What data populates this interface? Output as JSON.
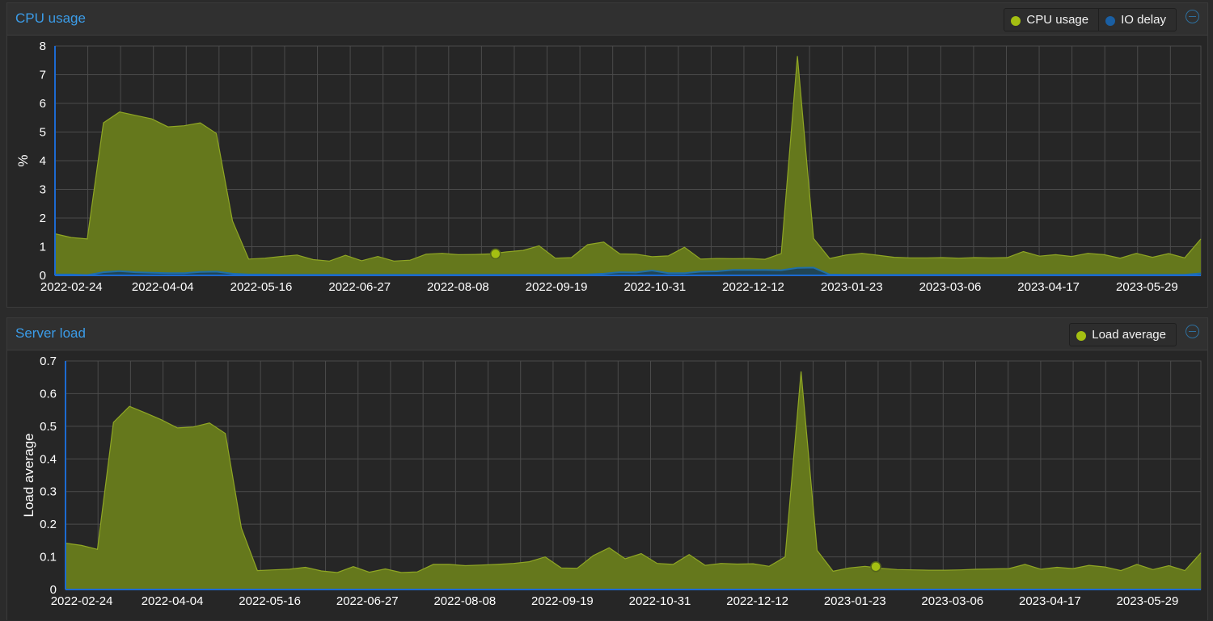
{
  "colors": {
    "cpu_fill": "#65781c",
    "cpu_line": "#8fa624",
    "cpu_dot": "#a4bf12",
    "io_fill": "#1a3f5c",
    "io_line": "#1f6fa8",
    "io_dot": "#1a5fa3",
    "grid": "#4b4b4b",
    "axis": "#1c6ad1"
  },
  "panels": {
    "cpu": {
      "title": "CPU usage",
      "legend": [
        {
          "label": "CPU usage",
          "color": "#a4bf12"
        },
        {
          "label": "IO delay",
          "color": "#1a5fa3"
        }
      ]
    },
    "load": {
      "title": "Server load",
      "legend": [
        {
          "label": "Load average",
          "color": "#a4bf12"
        }
      ]
    }
  },
  "chart_data": [
    {
      "type": "area",
      "title": "CPU usage",
      "xlabel": "",
      "ylabel": "%",
      "ylim": [
        0,
        8
      ],
      "yticks": [
        "0",
        "1",
        "2",
        "3",
        "4",
        "5",
        "6",
        "7",
        "8"
      ],
      "xticks": [
        "2022-02-24",
        "2022-04-04",
        "2022-05-16",
        "2022-06-27",
        "2022-08-08",
        "2022-09-19",
        "2022-10-31",
        "2022-12-12",
        "2023-01-23",
        "2023-03-06",
        "2023-04-17",
        "2023-05-29"
      ],
      "grid": true,
      "legend_position": "top-right",
      "x_start": "2022-02-17",
      "x_end": "2023-06-21",
      "series": [
        {
          "name": "CPU usage",
          "values": [
            1.45,
            1.32,
            1.27,
            5.32,
            5.7,
            5.58,
            5.46,
            5.18,
            5.22,
            5.32,
            4.95,
            1.9,
            0.57,
            0.6,
            0.66,
            0.71,
            0.55,
            0.5,
            0.7,
            0.51,
            0.66,
            0.5,
            0.53,
            0.74,
            0.77,
            0.72,
            0.73,
            0.75,
            0.82,
            0.87,
            1.03,
            0.6,
            0.62,
            1.07,
            1.16,
            0.75,
            0.74,
            0.65,
            0.68,
            0.98,
            0.57,
            0.59,
            0.58,
            0.59,
            0.56,
            0.76,
            7.65,
            1.29,
            0.59,
            0.71,
            0.77,
            0.7,
            0.63,
            0.61,
            0.61,
            0.62,
            0.6,
            0.62,
            0.61,
            0.62,
            0.83,
            0.67,
            0.72,
            0.66,
            0.77,
            0.72,
            0.6,
            0.77,
            0.63,
            0.76,
            0.61,
            1.27
          ]
        },
        {
          "name": "IO delay",
          "values": [
            0.03,
            0.03,
            0.01,
            0.11,
            0.15,
            0.11,
            0.09,
            0.08,
            0.08,
            0.12,
            0.13,
            0.06,
            0.03,
            0.03,
            0.02,
            0.02,
            0.02,
            0.02,
            0.02,
            0.02,
            0.02,
            0.02,
            0.02,
            0.02,
            0.02,
            0.02,
            0.02,
            0.02,
            0.02,
            0.02,
            0.02,
            0.02,
            0.02,
            0.03,
            0.06,
            0.11,
            0.1,
            0.17,
            0.08,
            0.08,
            0.13,
            0.14,
            0.19,
            0.19,
            0.19,
            0.18,
            0.26,
            0.27,
            0.03,
            0.02,
            0.02,
            0.02,
            0.02,
            0.02,
            0.02,
            0.02,
            0.02,
            0.02,
            0.02,
            0.02,
            0.02,
            0.02,
            0.02,
            0.02,
            0.02,
            0.02,
            0.02,
            0.02,
            0.02,
            0.02,
            0.02,
            0.07
          ]
        }
      ],
      "marker": {
        "series": "CPU usage",
        "date": "2022-08-24",
        "value": 0.75
      }
    },
    {
      "type": "area",
      "title": "Server load",
      "xlabel": "",
      "ylabel": "Load average",
      "ylim": [
        0,
        0.7
      ],
      "yticks": [
        "0",
        "0.1",
        "0.2",
        "0.3",
        "0.4",
        "0.5",
        "0.6",
        "0.7"
      ],
      "xticks": [
        "2022-02-24",
        "2022-04-04",
        "2022-05-16",
        "2022-06-27",
        "2022-08-08",
        "2022-09-19",
        "2022-10-31",
        "2022-12-12",
        "2023-01-23",
        "2023-03-06",
        "2023-04-17",
        "2023-05-29"
      ],
      "grid": true,
      "legend_position": "top-right",
      "x_start": "2022-02-17",
      "x_end": "2023-06-21",
      "series": [
        {
          "name": "Load average",
          "values": [
            0.142,
            0.135,
            0.123,
            0.512,
            0.561,
            0.541,
            0.52,
            0.495,
            0.498,
            0.51,
            0.478,
            0.188,
            0.058,
            0.06,
            0.062,
            0.068,
            0.057,
            0.052,
            0.07,
            0.053,
            0.063,
            0.052,
            0.054,
            0.077,
            0.077,
            0.073,
            0.075,
            0.077,
            0.08,
            0.085,
            0.1,
            0.066,
            0.065,
            0.104,
            0.128,
            0.094,
            0.11,
            0.08,
            0.077,
            0.107,
            0.074,
            0.08,
            0.078,
            0.079,
            0.071,
            0.1,
            0.668,
            0.12,
            0.056,
            0.066,
            0.071,
            0.065,
            0.061,
            0.06,
            0.059,
            0.059,
            0.06,
            0.062,
            0.063,
            0.064,
            0.077,
            0.062,
            0.068,
            0.064,
            0.074,
            0.069,
            0.058,
            0.077,
            0.061,
            0.073,
            0.058,
            0.112
          ]
        }
      ],
      "marker": {
        "series": "Load average",
        "date": "2023-02-01",
        "value": 0.07
      }
    }
  ]
}
